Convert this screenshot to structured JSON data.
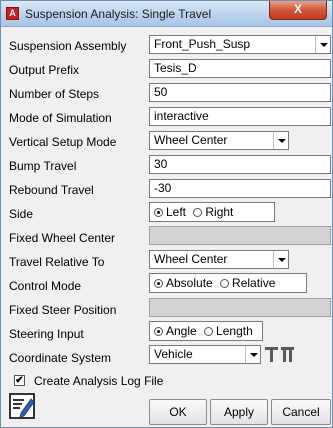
{
  "window": {
    "title": "Suspension Analysis: Single Travel",
    "app_icon_letter": "A",
    "close_glyph": "X"
  },
  "form": {
    "suspension_assembly": {
      "label": "Suspension Assembly",
      "value": "Front_Push_Susp"
    },
    "output_prefix": {
      "label": "Output Prefix",
      "value": "Tesis_D"
    },
    "number_of_steps": {
      "label": "Number of Steps",
      "value": "50"
    },
    "mode_of_simulation": {
      "label": "Mode of Simulation",
      "value": "interactive"
    },
    "vertical_setup_mode": {
      "label": "Vertical Setup Mode",
      "value": "Wheel Center"
    },
    "bump_travel": {
      "label": "Bump Travel",
      "value": "30"
    },
    "rebound_travel": {
      "label": "Rebound Travel",
      "value": "-30"
    },
    "side": {
      "label": "Side",
      "options": [
        "Left",
        "Right"
      ],
      "selected": "Left"
    },
    "fixed_wheel_center": {
      "label": "Fixed Wheel Center",
      "value": ""
    },
    "travel_relative_to": {
      "label": "Travel Relative To",
      "value": "Wheel Center"
    },
    "control_mode": {
      "label": "Control Mode",
      "options": [
        "Absolute",
        "Relative"
      ],
      "selected": "Absolute"
    },
    "fixed_steer_position": {
      "label": "Fixed Steer Position",
      "value": ""
    },
    "steering_input": {
      "label": "Steering Input",
      "options": [
        "Angle",
        "Length"
      ],
      "selected": "Angle"
    },
    "coordinate_system": {
      "label": "Coordinate System",
      "value": "Vehicle"
    }
  },
  "log_file": {
    "label": "Create Analysis Log File",
    "checked": true
  },
  "buttons": {
    "ok": "OK",
    "apply": "Apply",
    "cancel": "Cancel"
  },
  "icons": {
    "help": "edit-pencil-icon",
    "coordinate_system": "coordinate-system-icon"
  }
}
